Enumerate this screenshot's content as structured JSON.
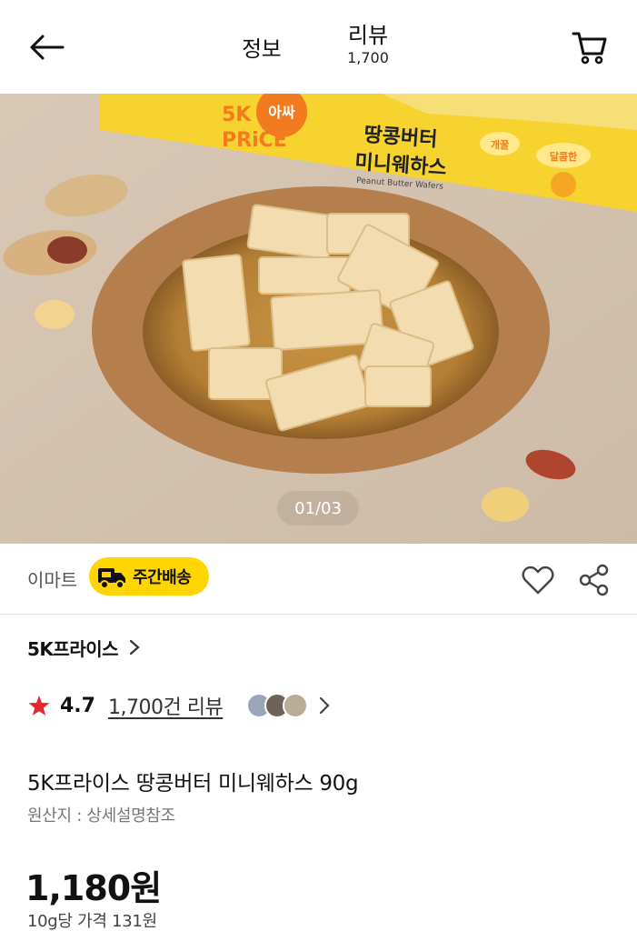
{
  "header": {
    "tab_info": "정보",
    "tab_review": "리뷰",
    "review_count": "1,700"
  },
  "hero": {
    "pager": "01/03",
    "package": {
      "brand_line1": "5K",
      "brand_line2": "PRiCE",
      "name_line1": "땅콩버터",
      "name_line2": "미니웨하스",
      "name_en": "Peanut Butter Wafers",
      "tag1": "개꿀",
      "tag2": "달콤한",
      "tag3": "아싸"
    }
  },
  "seller": {
    "mart": "이마트",
    "badge": "주간배송"
  },
  "brand": {
    "name": "5K프라이스"
  },
  "rating": {
    "score": "4.7",
    "reviews": "1,700건 리뷰"
  },
  "product": {
    "title": "5K프라이스 땅콩버터 미니웨하스 90g",
    "origin": "원산지 : 상세설명참조",
    "price": "1,180원",
    "unit_price": "10g당 가격 131원"
  },
  "colors": {
    "accent_yellow": "#ffd400",
    "star_red": "#e8262d",
    "package_yellow": "#f6d32e",
    "package_orange": "#f27b1f"
  }
}
